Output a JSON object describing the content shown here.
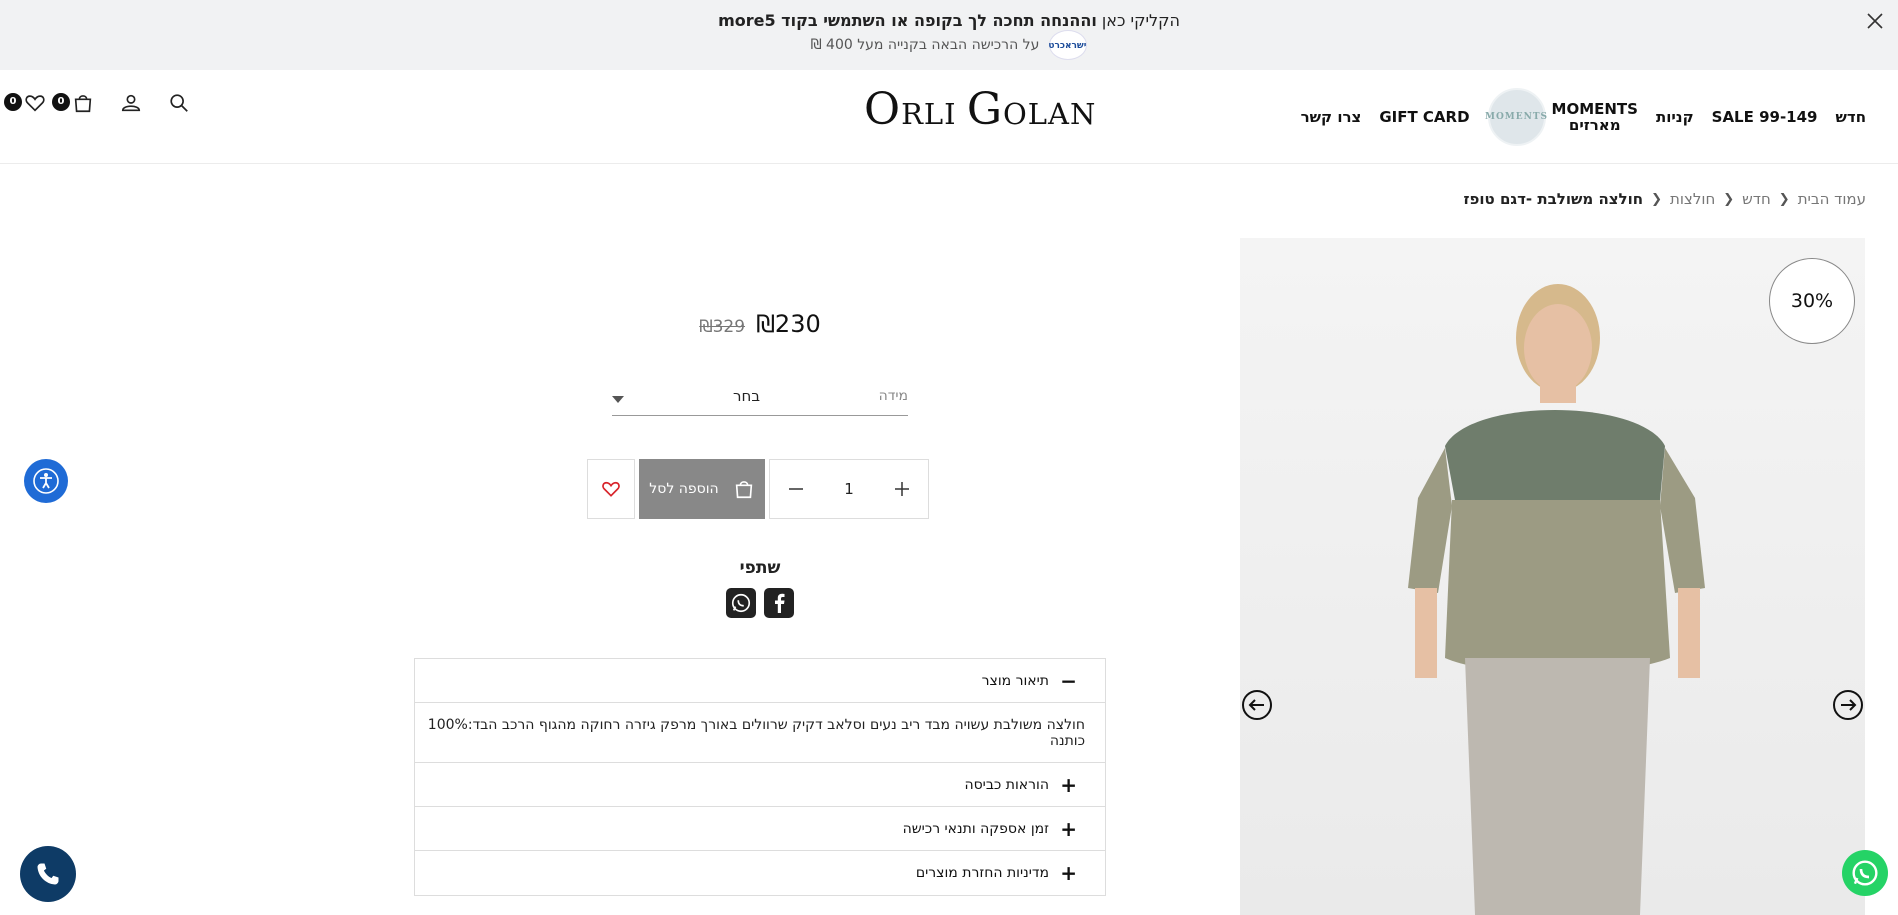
{
  "announcement": {
    "line1_prefix": "הקליקי כאן",
    "line1_bold": "וההנחה תחכה לך בקופה או השתמשי בקוד more5",
    "line2": "על הרכישה הבאה בקנייה מעל 400 ₪",
    "badge": "ישראכרט",
    "close_icon": "close-icon"
  },
  "header": {
    "brand": {
      "first_cap": "O",
      "first_rest": "RLI ",
      "second_cap": "G",
      "second_rest": "OLAN"
    },
    "nav": [
      {
        "label": "חדש"
      },
      {
        "label": "SALE 99-149"
      },
      {
        "label": "קניות"
      },
      {
        "label": "MOMENTS\nמארזים",
        "logo_text": "MOMENTS"
      },
      {
        "label": "GIFT CARD"
      },
      {
        "label": "צרו קשר"
      }
    ],
    "cart_count": "0",
    "wishlist_count": "0",
    "icons": [
      "heart-icon",
      "bag-icon",
      "user-icon",
      "search-icon"
    ]
  },
  "breadcrumb": {
    "items": [
      "עמוד הבית",
      "חדש",
      "חולצות"
    ],
    "current": "חולצה משולבת -דגם טופז"
  },
  "product": {
    "discount": "30%",
    "price_new": "₪230",
    "price_old": "₪329",
    "size_label": "מידה",
    "size_value": "בחר",
    "quantity": "1",
    "add_to_cart": "הוספה לסל",
    "share_title": "שתפי"
  },
  "accordion": {
    "items": [
      {
        "title": "תיאור מוצר",
        "open": true,
        "body": "חולצה משולבת עשויה מבד ריב נעים וסלאב דקיק שרוולים באורך מרפק גיזרה רחוקה מהגוף הרכב הבד:100% כותנה"
      },
      {
        "title": "הוראות כביסה",
        "open": false
      },
      {
        "title": "זמן אספקה ותנאי רכישה",
        "open": false
      },
      {
        "title": "מדיניות החזרת מוצרים",
        "open": false
      }
    ]
  },
  "colors": {
    "top_dark": "#6f7d6c",
    "top_light": "#9c9b83",
    "pants": "#bdb8b0",
    "skin": "#e6c0a4",
    "hair": "#d6b98c",
    "accent_blue": "#1f6bd6",
    "call_navy": "#0e3b66",
    "whatsapp": "#25d366"
  }
}
